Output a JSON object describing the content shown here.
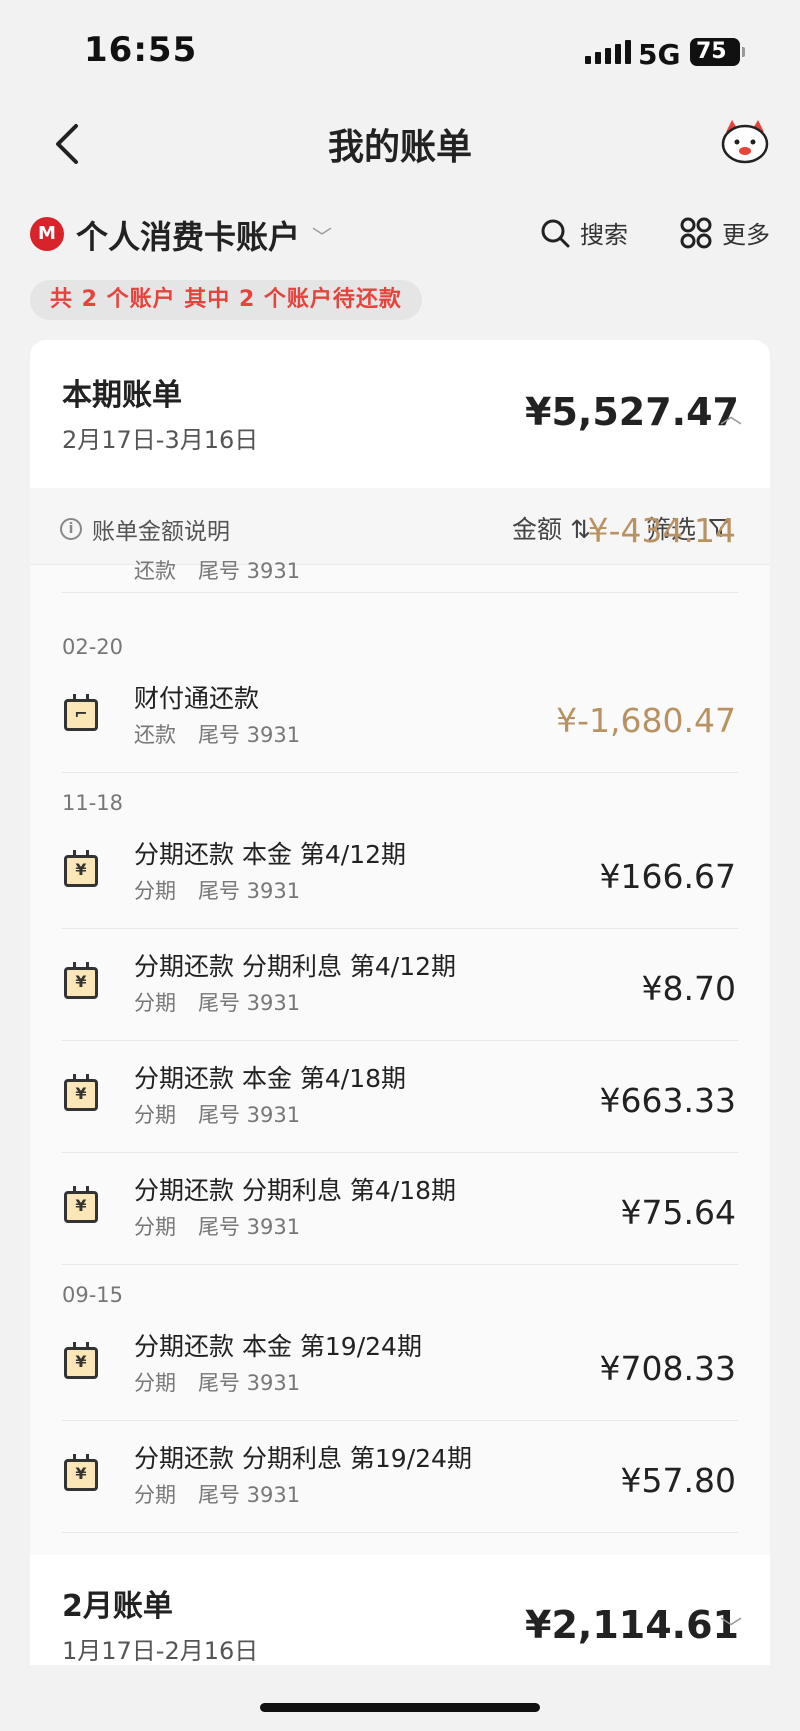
{
  "status": {
    "time": "16:55",
    "network": "5G",
    "battery": "75"
  },
  "nav": {
    "title": "我的账单",
    "back_icon": "chevron-left-icon",
    "mascot_icon": "mascot-icon"
  },
  "account": {
    "logo_text": "M",
    "name": "个人消费卡账户",
    "search_label": "搜索",
    "more_label": "更多",
    "summary": "共 2 个账户  其中 2 个账户待还款"
  },
  "current": {
    "title": "本期账单",
    "range": "2月17日-3月16日",
    "amount": "¥5,527.47"
  },
  "toolbar": {
    "info_label": "账单金额说明",
    "amount_sort_label": "金额 ⇅",
    "filter_label": "筛选"
  },
  "partial_row": {
    "sub_type": "还款",
    "sub_tail": "尾号 3931",
    "amount": "¥-434.14"
  },
  "groups": [
    {
      "date": "02-20",
      "items": [
        {
          "name": "财付通还款",
          "type": "还款",
          "tail": "尾号 3931",
          "amount": "¥-1,680.47",
          "negative": true
        }
      ]
    },
    {
      "date": "11-18",
      "items": [
        {
          "name": "分期还款 本金 第4/12期",
          "type": "分期",
          "tail": "尾号 3931",
          "amount": "¥166.67"
        },
        {
          "name": "分期还款 分期利息 第4/12期",
          "type": "分期",
          "tail": "尾号 3931",
          "amount": "¥8.70"
        },
        {
          "name": "分期还款 本金 第4/18期",
          "type": "分期",
          "tail": "尾号 3931",
          "amount": "¥663.33"
        },
        {
          "name": "分期还款 分期利息 第4/18期",
          "type": "分期",
          "tail": "尾号 3931",
          "amount": "¥75.64"
        }
      ]
    },
    {
      "date": "09-15",
      "items": [
        {
          "name": "分期还款 本金 第19/24期",
          "type": "分期",
          "tail": "尾号 3931",
          "amount": "¥708.33"
        },
        {
          "name": "分期还款 分期利息 第19/24期",
          "type": "分期",
          "tail": "尾号 3931",
          "amount": "¥57.80"
        }
      ]
    }
  ],
  "previous": {
    "title": "2月账单",
    "range": "1月17日-2月16日",
    "amount": "¥2,114.61"
  }
}
